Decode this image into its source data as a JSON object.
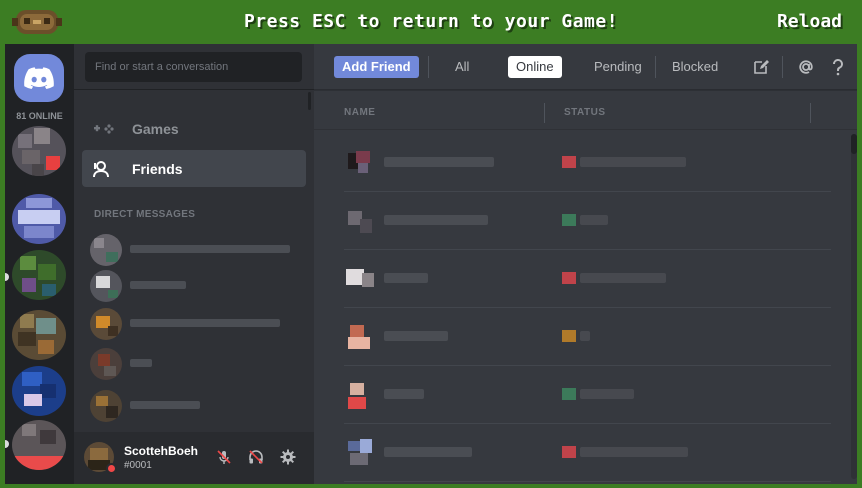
{
  "overlay": {
    "message": "Press ESC to return to your Game!",
    "reload_label": "Reload",
    "colors": {
      "bar": "#3c7d23",
      "text": "#ffffff"
    }
  },
  "guilds": {
    "online_count": "81 ONLINE",
    "home_icon": "discord-logo-icon"
  },
  "sidebar": {
    "search_placeholder": "Find or start a conversation",
    "nav": [
      {
        "label": "Games",
        "icon": "gamepad-icon"
      },
      {
        "label": "Friends",
        "icon": "friends-icon"
      }
    ],
    "dm_header": "DIRECT MESSAGES"
  },
  "user": {
    "name": "ScottehBoeh",
    "tag": "#0001",
    "status_color": "#f04747"
  },
  "toolbar": {
    "add_friend": "Add Friend",
    "tabs": [
      "All",
      "Online",
      "Pending",
      "Blocked"
    ],
    "selected_tab": "Online"
  },
  "friends_list": {
    "columns": [
      "NAME",
      "STATUS"
    ]
  },
  "colors": {
    "accent": "#7289da",
    "background": "#36393f",
    "sidebar": "#2f3136",
    "rail": "#202225",
    "dnd": "#f04747",
    "online": "#43b581"
  }
}
